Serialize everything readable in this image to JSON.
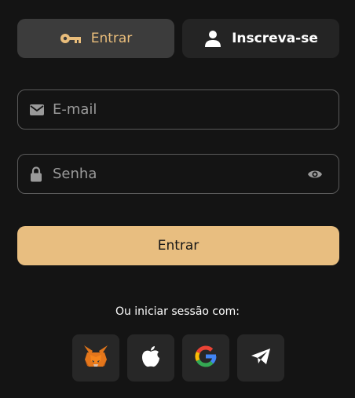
{
  "tabs": {
    "login_label": "Entrar",
    "signup_label": "Inscreva-se"
  },
  "form": {
    "email_placeholder": "E-mail",
    "email_value": "",
    "password_placeholder": "Senha",
    "password_value": "",
    "submit_label": "Entrar"
  },
  "social": {
    "label": "Ou iniciar sessão com:",
    "providers": [
      "metamask-icon",
      "apple-icon",
      "google-icon",
      "telegram-icon"
    ]
  },
  "colors": {
    "accent": "#e8be80",
    "background": "#141414",
    "tab_active": "#3c3c3c",
    "tab_inactive": "#242424"
  }
}
